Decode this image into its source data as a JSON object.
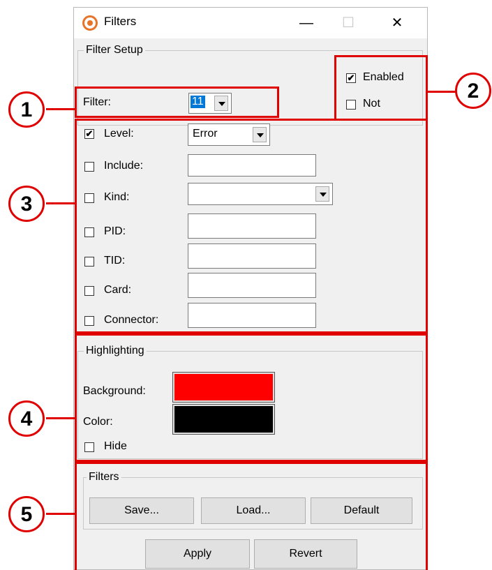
{
  "window": {
    "title": "Filters",
    "minimize_glyph": "—",
    "maximize_glyph": "☐",
    "close_glyph": "✕"
  },
  "filter_setup": {
    "legend": "Filter Setup",
    "filter_label": "Filter:",
    "filter_value": "11",
    "enabled_label": "Enabled",
    "enabled_checked": true,
    "not_label": "Not",
    "not_checked": false
  },
  "criteria": [
    {
      "label": "Level:",
      "checked": true,
      "control": "combo",
      "value": "Error"
    },
    {
      "label": "Include:",
      "checked": false,
      "control": "text",
      "value": ""
    },
    {
      "label": "Kind:",
      "checked": false,
      "control": "combo",
      "value": ""
    },
    {
      "label": "PID:",
      "checked": false,
      "control": "text",
      "value": ""
    },
    {
      "label": "TID:",
      "checked": false,
      "control": "text",
      "value": ""
    },
    {
      "label": "Card:",
      "checked": false,
      "control": "text",
      "value": ""
    },
    {
      "label": "Connector:",
      "checked": false,
      "control": "text",
      "value": ""
    }
  ],
  "highlighting": {
    "legend": "Highlighting",
    "background_label": "Background:",
    "background_color": "#ff0000",
    "color_label": "Color:",
    "color_value": "#000000",
    "hide_label": "Hide",
    "hide_checked": false
  },
  "filters_group": {
    "legend": "Filters",
    "save_label": "Save...",
    "load_label": "Load...",
    "default_label": "Default"
  },
  "actions": {
    "apply_label": "Apply",
    "revert_label": "Revert"
  },
  "callouts": [
    "1",
    "2",
    "3",
    "4",
    "5"
  ],
  "colors": {
    "callout_red": "#e00000",
    "selection_blue": "#0078d7",
    "app_icon_orange": "#e8742a"
  }
}
